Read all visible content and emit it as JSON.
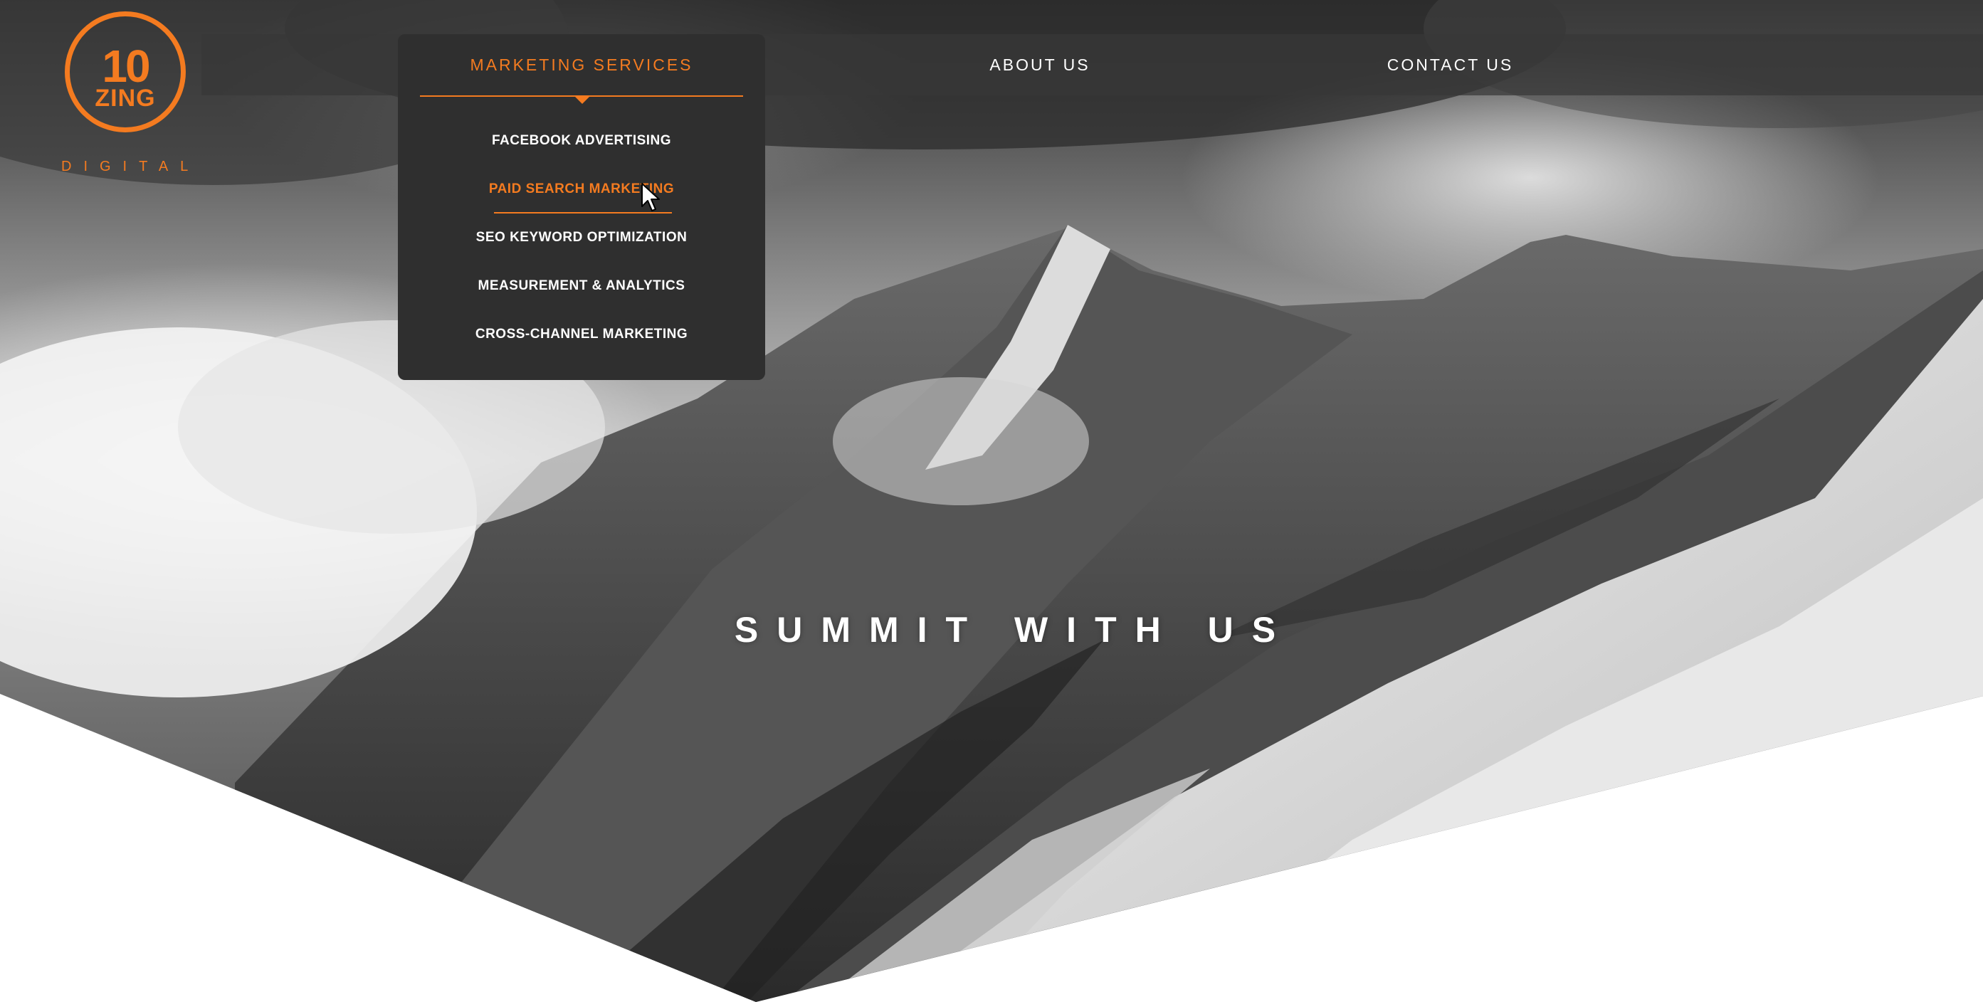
{
  "brand": {
    "logo_mark": "10",
    "logo_word": "ZING",
    "logo_sub": "DIGITAL",
    "accent_color": "#f47b20"
  },
  "nav": {
    "items": [
      {
        "label": "MARKETING SERVICES",
        "active": true
      },
      {
        "label": "ABOUT US"
      },
      {
        "label": "CONTACT US"
      }
    ]
  },
  "dropdown": {
    "items": [
      {
        "label": "FACEBOOK ADVERTISING"
      },
      {
        "label": "PAID SEARCH MARKETING",
        "hovered": true
      },
      {
        "label": "SEO KEYWORD OPTIMIZATION"
      },
      {
        "label": "MEASUREMENT & ANALYTICS"
      },
      {
        "label": "CROSS-CHANNEL MARKETING"
      }
    ]
  },
  "hero": {
    "headline": "SUMMIT WITH US"
  }
}
